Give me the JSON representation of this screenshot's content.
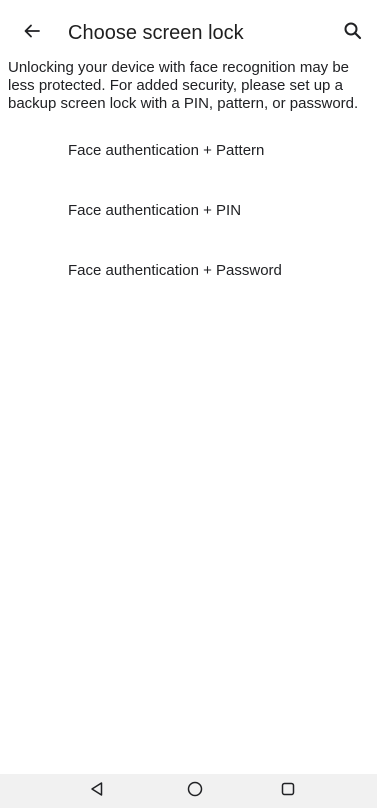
{
  "header": {
    "title": "Choose screen lock",
    "back_icon": "arrow-left-icon",
    "search_icon": "search-icon"
  },
  "description": "Unlocking your device with face recognition may be less protected. For added security, please set up a backup screen lock with a PIN, pattern, or password.",
  "options": [
    {
      "label": "Face authentication + Pattern"
    },
    {
      "label": "Face authentication + PIN"
    },
    {
      "label": "Face authentication + Password"
    }
  ],
  "nav_bar": {
    "back_icon": "triangle-back-icon",
    "home_icon": "circle-home-icon",
    "recents_icon": "square-recents-icon"
  }
}
